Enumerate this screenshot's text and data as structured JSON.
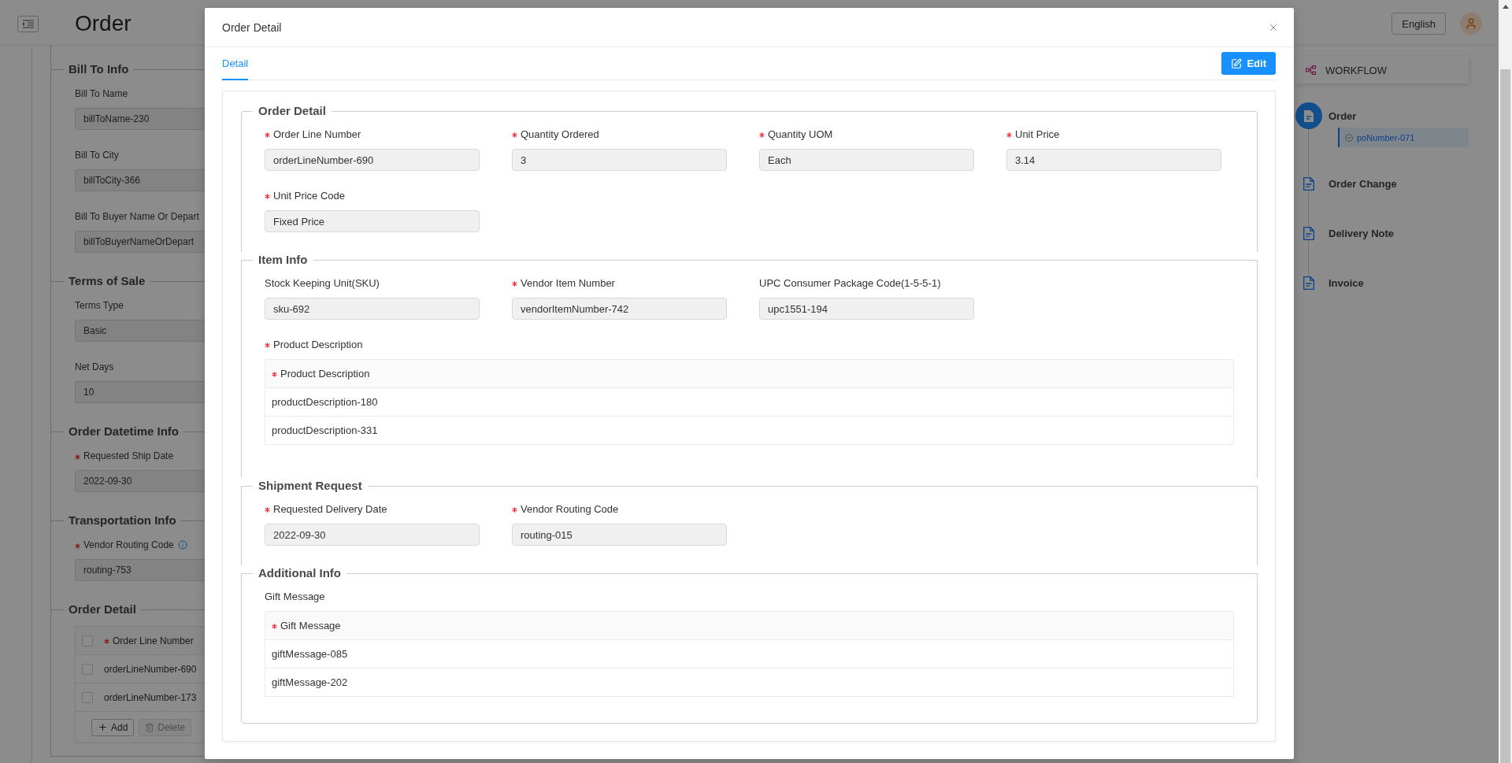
{
  "page": {
    "title": "Order",
    "language_button": "English",
    "sections": [
      {
        "title": "Bill To Info",
        "fields": [
          {
            "label": "Bill To Name",
            "required": false,
            "tooltip": false,
            "value": "billToName-230",
            "disabled": true
          },
          {
            "label": "Bill To City",
            "required": false,
            "tooltip": false,
            "value": "billToCity-366",
            "disabled": true
          },
          {
            "label": "Bill To Buyer Name Or Depart",
            "required": false,
            "tooltip": false,
            "value": "billToBuyerNameOrDepart",
            "disabled": true
          }
        ]
      },
      {
        "title": "Terms of Sale",
        "fields": [
          {
            "label": "Terms Type",
            "required": false,
            "tooltip": false,
            "value": "Basic",
            "disabled": true
          },
          {
            "label": "Net Days",
            "required": false,
            "tooltip": false,
            "value": "10",
            "disabled": true
          }
        ]
      },
      {
        "title": "Order Datetime Info",
        "fields": [
          {
            "label": "Requested Ship Date",
            "required": true,
            "tooltip": false,
            "value": "2022-09-30",
            "disabled": true
          }
        ]
      },
      {
        "title": "Transportation Info",
        "fields": [
          {
            "label": "Vendor Routing Code",
            "required": true,
            "tooltip": true,
            "value": "routing-753",
            "disabled": true
          }
        ]
      },
      {
        "title": "Order Detail",
        "table": {
          "header_checked": false,
          "columns": [
            {
              "label": "Order Line Number",
              "required": true
            }
          ],
          "rows": [
            {
              "checked": false,
              "cells": [
                "orderLineNumber-690"
              ]
            },
            {
              "checked": false,
              "cells": [
                "orderLineNumber-173"
              ]
            }
          ],
          "buttons": [
            {
              "kind": "add",
              "label": "Add",
              "disabled": false
            },
            {
              "kind": "delete",
              "label": "Delete",
              "disabled": true
            }
          ]
        }
      }
    ]
  },
  "workflow": {
    "title": "WORKFLOW",
    "steps": [
      {
        "label": "Order",
        "selected": true,
        "children": [
          {
            "label": "poNumber-071",
            "selected": true
          }
        ]
      },
      {
        "label": "Order Change",
        "selected": false
      },
      {
        "label": "Delivery Note",
        "selected": false
      },
      {
        "label": "Invoice",
        "selected": false
      }
    ]
  },
  "modal": {
    "title": "Order Detail",
    "tabs": [
      {
        "label": "Detail",
        "selected": true
      }
    ],
    "edit_button": "Edit",
    "sections": [
      {
        "title": "Order Detail",
        "fields": [
          {
            "label": "Order Line Number",
            "required": true,
            "value": "orderLineNumber-690",
            "disabled": true
          },
          {
            "label": "Quantity Ordered",
            "required": true,
            "value": "3",
            "disabled": true
          },
          {
            "label": "Quantity UOM",
            "required": true,
            "value": "Each",
            "disabled": true
          },
          {
            "label": "Unit Price",
            "required": true,
            "value": "3.14",
            "disabled": true
          },
          {
            "label": "Unit Price Code",
            "required": true,
            "value": "Fixed Price",
            "disabled": true
          }
        ]
      },
      {
        "title": "Item Info",
        "fields": [
          {
            "label": "Stock Keeping Unit(SKU)",
            "required": false,
            "value": "sku-692",
            "disabled": true
          },
          {
            "label": "Vendor Item Number",
            "required": true,
            "value": "vendorItemNumber-742",
            "disabled": true
          },
          {
            "label": "UPC Consumer Package Code(1-5-5-1)",
            "required": false,
            "value": "upc1551-194",
            "disabled": true
          }
        ],
        "tables": [
          {
            "label": "Product Description",
            "required": true,
            "columns": [
              {
                "label": "Product Description",
                "required": true
              }
            ],
            "rows": [
              [
                "productDescription-180"
              ],
              [
                "productDescription-331"
              ]
            ]
          }
        ]
      },
      {
        "title": "Shipment Request",
        "fields": [
          {
            "label": "Requested Delivery Date",
            "required": true,
            "value": "2022-09-30",
            "disabled": true
          },
          {
            "label": "Vendor Routing Code",
            "required": true,
            "value": "routing-015",
            "disabled": true
          }
        ]
      },
      {
        "title": "Additional Info",
        "tables": [
          {
            "label": "Gift Message",
            "required": false,
            "columns": [
              {
                "label": "Gift Message",
                "required": true
              }
            ],
            "rows": [
              [
                "giftMessage-085"
              ],
              [
                "giftMessage-202"
              ]
            ]
          }
        ]
      }
    ]
  }
}
